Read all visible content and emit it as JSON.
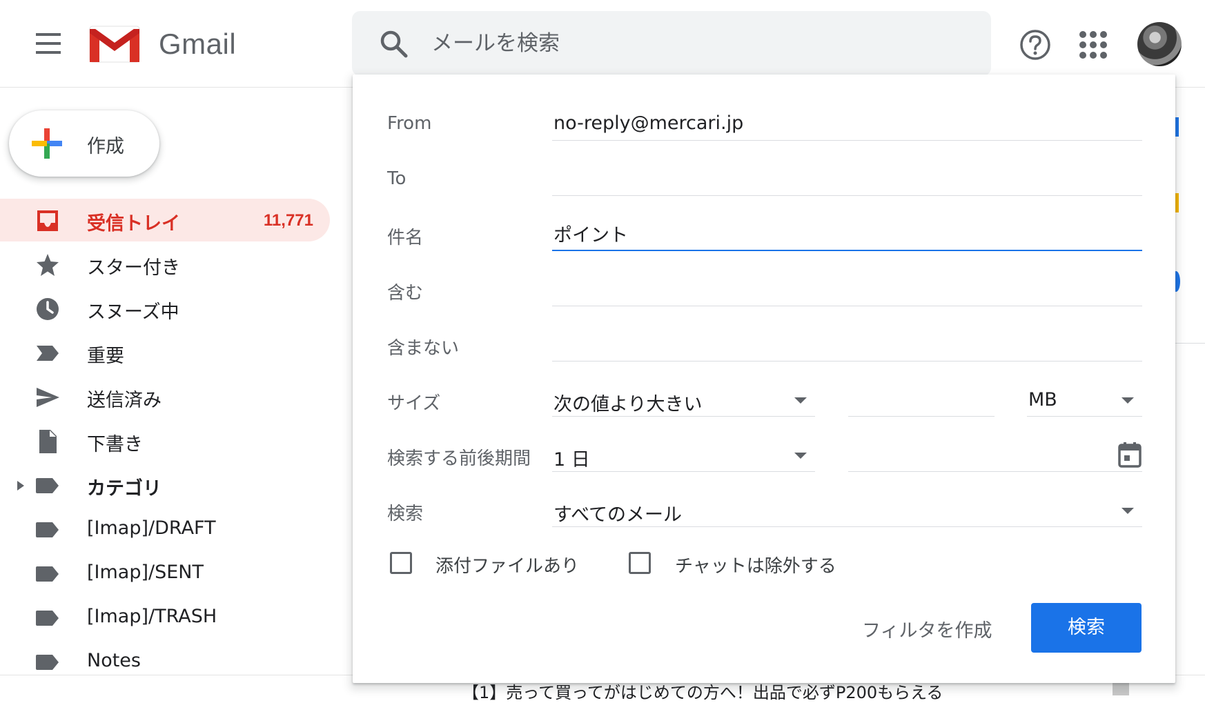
{
  "header": {
    "app_name": "Gmail",
    "search_placeholder": "メールを検索"
  },
  "compose": {
    "label": "作成"
  },
  "sidebar": {
    "items": [
      {
        "label": "受信トレイ",
        "count": "11,771",
        "icon": "inbox-icon"
      },
      {
        "label": "スター付き",
        "icon": "star-icon"
      },
      {
        "label": "スヌーズ中",
        "icon": "clock-icon"
      },
      {
        "label": "重要",
        "icon": "important-icon"
      },
      {
        "label": "送信済み",
        "icon": "send-icon"
      },
      {
        "label": "下書き",
        "icon": "draft-icon"
      },
      {
        "label": "カテゴリ",
        "icon": "label-icon"
      },
      {
        "label": "[Imap]/DRAFT",
        "icon": "label-icon"
      },
      {
        "label": "[Imap]/SENT",
        "icon": "label-icon"
      },
      {
        "label": "[Imap]/TRASH",
        "icon": "label-icon"
      },
      {
        "label": "Notes",
        "icon": "label-icon"
      }
    ]
  },
  "advanced_search": {
    "from_label": "From",
    "from_value": "no-reply@mercari.jp",
    "to_label": "To",
    "to_value": "",
    "subject_label": "件名",
    "subject_value": "ポイント",
    "has_words_label": "含む",
    "has_words_value": "",
    "no_words_label": "含まない",
    "no_words_value": "",
    "size_label": "サイズ",
    "size_operator": "次の値より大きい",
    "size_value": "",
    "size_unit": "MB",
    "date_label": "検索する前後期間",
    "date_range": "1 日",
    "date_value": "",
    "scope_label": "検索",
    "scope_value": "すべてのメール",
    "has_attachment_label": "添付ファイルあり",
    "exclude_chats_label": "チャットは除外する",
    "create_filter_label": "フィルタを作成",
    "search_button_label": "検索"
  },
  "background": {
    "partial_email_subject": "【1】売って買ってがはじめての方へ！出品で必ずP200もらえる"
  },
  "colors": {
    "accent_blue": "#1a73e8",
    "inbox_red": "#d93025",
    "inbox_highlight": "#fce8e6"
  }
}
